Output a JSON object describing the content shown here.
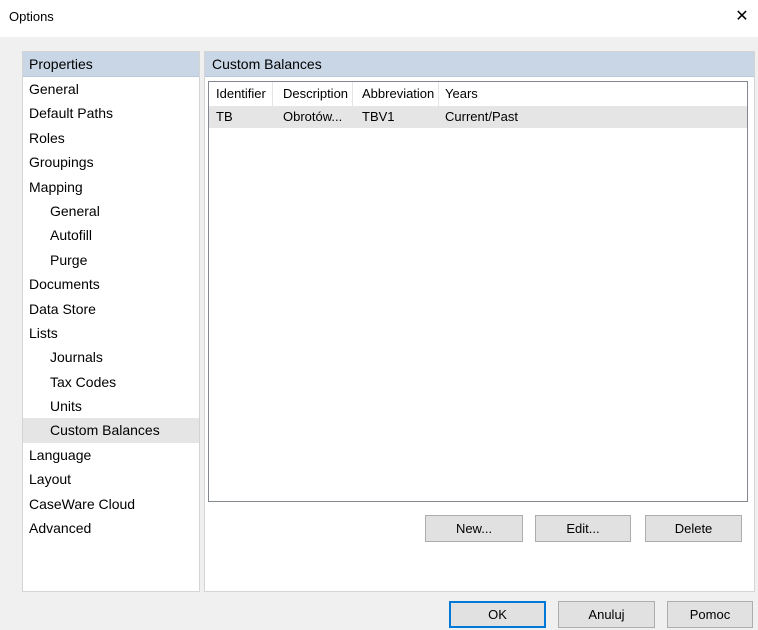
{
  "window": {
    "title": "Options",
    "close_glyph": "✕"
  },
  "sidebar": {
    "header": "Properties",
    "items": [
      {
        "label": "General",
        "indent": false,
        "selected": false
      },
      {
        "label": "Default Paths",
        "indent": false,
        "selected": false
      },
      {
        "label": "Roles",
        "indent": false,
        "selected": false
      },
      {
        "label": "Groupings",
        "indent": false,
        "selected": false
      },
      {
        "label": "Mapping",
        "indent": false,
        "selected": false
      },
      {
        "label": "General",
        "indent": true,
        "selected": false
      },
      {
        "label": "Autofill",
        "indent": true,
        "selected": false
      },
      {
        "label": "Purge",
        "indent": true,
        "selected": false
      },
      {
        "label": "Documents",
        "indent": false,
        "selected": false
      },
      {
        "label": "Data Store",
        "indent": false,
        "selected": false
      },
      {
        "label": "Lists",
        "indent": false,
        "selected": false
      },
      {
        "label": "Journals",
        "indent": true,
        "selected": false
      },
      {
        "label": "Tax Codes",
        "indent": true,
        "selected": false
      },
      {
        "label": "Units",
        "indent": true,
        "selected": false
      },
      {
        "label": "Custom Balances",
        "indent": true,
        "selected": true
      },
      {
        "label": "Language",
        "indent": false,
        "selected": false
      },
      {
        "label": "Layout",
        "indent": false,
        "selected": false
      },
      {
        "label": "CaseWare Cloud",
        "indent": false,
        "selected": false
      },
      {
        "label": "Advanced",
        "indent": false,
        "selected": false
      }
    ]
  },
  "main": {
    "header": "Custom Balances",
    "table": {
      "columns": [
        "Identifier",
        "Description",
        "Abbreviation",
        "Years"
      ],
      "rows": [
        [
          "TB",
          "Obrotów...",
          "TBV1",
          "Current/Past"
        ]
      ]
    },
    "buttons": {
      "new": "New...",
      "edit": "Edit...",
      "delete": "Delete"
    }
  },
  "footer": {
    "ok": "OK",
    "cancel": "Anuluj",
    "help": "Pomoc"
  },
  "colors": {
    "header_bg": "#c8d6e6",
    "selection_bg": "#e5e5e5",
    "default_button_border": "#0078d7"
  }
}
